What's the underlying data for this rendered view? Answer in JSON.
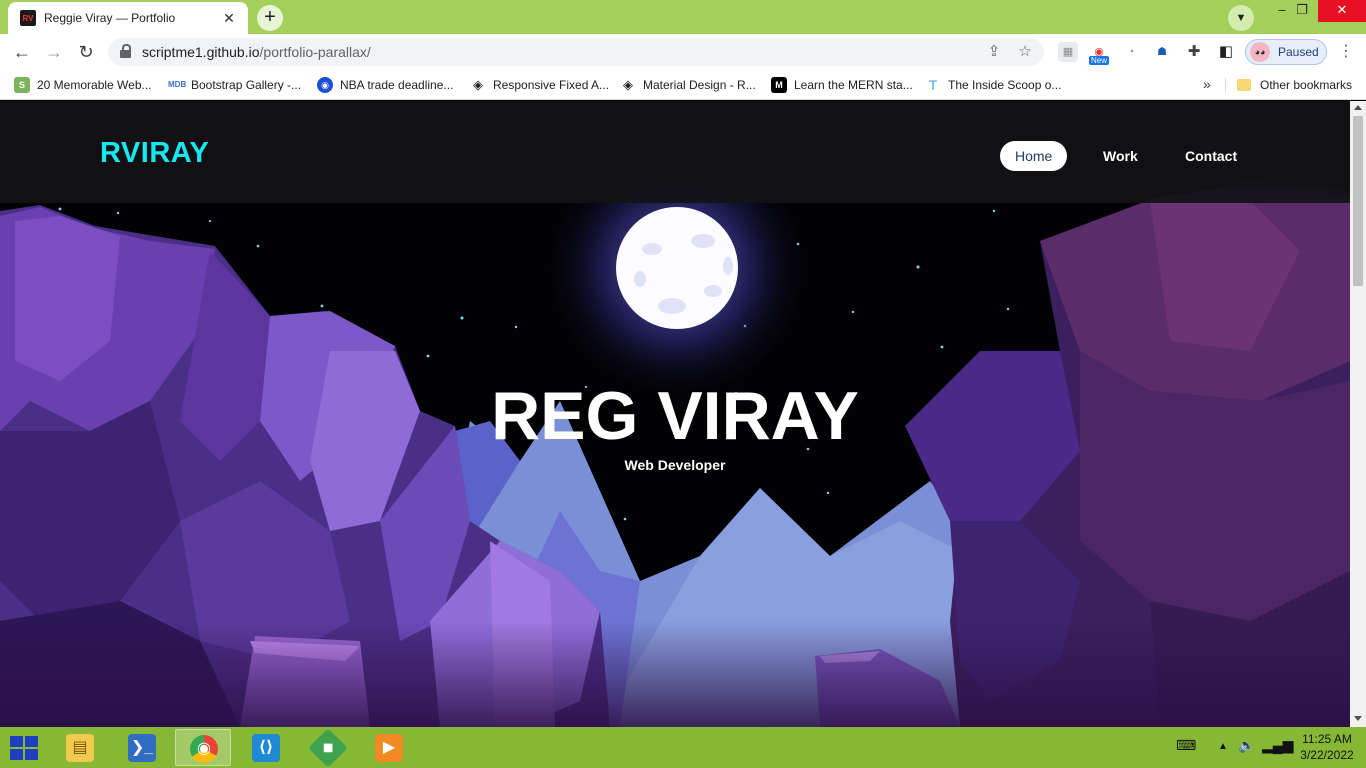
{
  "browser": {
    "tab": {
      "title": "Reggie Viray — Portfolio",
      "favicon_text": "RV"
    },
    "url": {
      "host": "scriptme1.github.io",
      "path": "/portfolio-parallax/"
    },
    "profile": {
      "label": "Paused"
    },
    "extension_badge": "New",
    "bookmarks": [
      {
        "label": "20 Memorable Web..."
      },
      {
        "label": "Bootstrap Gallery -..."
      },
      {
        "label": "NBA trade deadline..."
      },
      {
        "label": "Responsive Fixed A..."
      },
      {
        "label": "Material Design - R..."
      },
      {
        "label": "Learn the MERN sta..."
      },
      {
        "label": "The Inside Scoop o..."
      }
    ],
    "bookmarks_more": "»",
    "other_bookmarks": "Other bookmarks"
  },
  "site": {
    "logo": "RVIRAY",
    "nav": {
      "home": "Home",
      "work": "Work",
      "contact": "Contact"
    },
    "hero": {
      "title": "REG VIRAY",
      "subtitle": "Web Developer"
    },
    "colors": {
      "logo": "#18e6f0",
      "header_bg": "#121216"
    }
  },
  "taskbar": {
    "clock": {
      "time": "11:25 AM",
      "date": "3/22/2022"
    }
  }
}
